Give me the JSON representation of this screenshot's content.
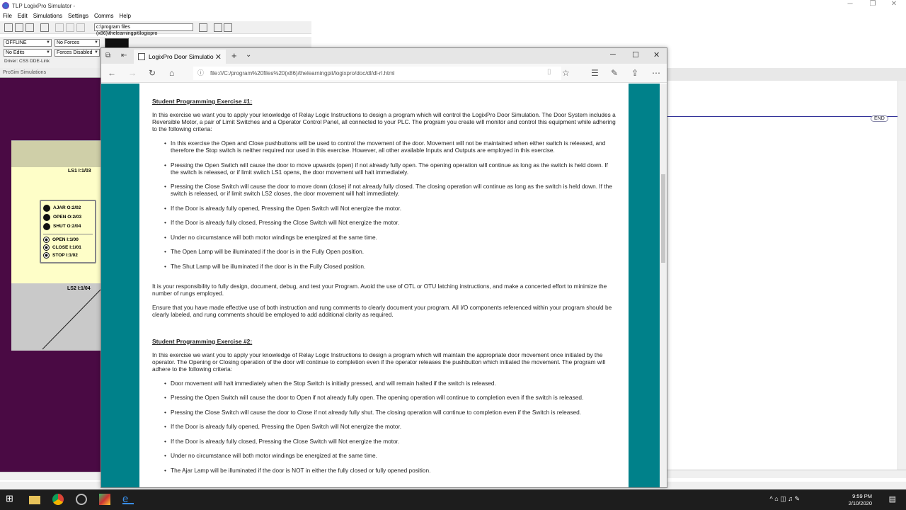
{
  "app": {
    "title": "TLP LogixPro Simulator -",
    "menu": [
      "File",
      "Edit",
      "Simulations",
      "Settings",
      "Comms",
      "Help"
    ],
    "path_field": "c:\\program files (x86)\\thelearningpit\\logixpro",
    "mode": "OFFLINE",
    "forces": "No Forces",
    "edits": "No Edits",
    "forces_disabled": "Forces Disabled",
    "driver": "Driver: CSS DDE-Link",
    "prosim_title": "ProSim Simulations",
    "end_label": "END"
  },
  "simulation": {
    "ls1": "LS1  I:1/03",
    "ls2": "LS2  I:1/04",
    "lamps": [
      {
        "label": "AJAR  O:2/02"
      },
      {
        "label": "OPEN  O:2/03"
      },
      {
        "label": "SHUT  O:2/04"
      }
    ],
    "buttons": [
      {
        "label": "OPEN   I:1/00"
      },
      {
        "label": "CLOSE I:1/01"
      },
      {
        "label": "STOP   I:1/02"
      }
    ]
  },
  "browser": {
    "tab_title": "LogixPro Door Simulatio",
    "url": "file:///C:/program%20files%20(x86)/thelearningpit/logixpro/doc/dl/dl-rl.html"
  },
  "doc": {
    "ex1_title": "Student Programming Exercise #1:",
    "ex1_intro": "In this exercise we want you to apply your knowledge of Relay Logic Instructions to design a program which will control the LogixPro Door Simulation. The Door System includes a Reversible Motor, a pair of Limit Switches and a Operator Control Panel, all connected to your PLC. The program you create will monitor and control this equipment while adhering to the following criteria:",
    "ex1_items": [
      "In this exercise the Open and Close pushbuttons will be used to control the movement of the door. Movement will not be maintained when either switch is released, and therefore the Stop switch is neither required nor used in this exercise. However, all other available Inputs and Outputs are employed in this exercise.",
      "Pressing the Open Switch will cause the door to move upwards (open) if not already fully open. The opening operation will continue as long as the switch is held down. If the switch is released, or if limit switch LS1 opens, the door movement will halt immediately.",
      "Pressing the Close Switch will cause the door to move down (close) if not already fully closed. The closing operation will continue as long as the switch is held down. If the switch is released, or if limit switch LS2 closes, the door movement will halt immediately.",
      "If the Door is already fully opened, Pressing the Open Switch will Not energize the motor.",
      "If the Door is already fully closed, Pressing the Close Switch will Not energize the motor.",
      "Under no circumstance will both motor windings be energized at the same time.",
      "The Open Lamp will be illuminated if the door is in the Fully Open position.",
      "The Shut Lamp will be illuminated if the door is in the Fully Closed position."
    ],
    "ex1_resp": "It is your responsibility to fully design, document, debug, and test your Program. Avoid the use of OTL or OTU latching instructions, and make a concerted effort to minimize the number of rungs employed.",
    "ex1_comments": "Ensure that you have made effective use of both instruction and rung comments to clearly document your program. All I/O components referenced within your program should be clearly labeled, and rung comments should be employed to add additional clarity as required.",
    "ex2_title": "Student Programming Exercise #2:",
    "ex2_intro": "In this exercise we want you to apply your knowledge of Relay Logic Instructions to design a program which will maintain the appropriate door movement once initiated by the operator. The Opening or Closing operation of the door will continue to completion even if the operator releases the pushbutton which initiated the movement. The program will adhere to the following criteria:",
    "ex2_items": [
      "Door movement will halt immediately when the Stop Switch is initially pressed, and will remain halted if the switch is released.",
      "Pressing the Open Switch will cause the door to Open if not already fully open. The opening operation will continue to completion even if the switch is released.",
      "Pressing the Close Switch will cause the door to Close if not already fully shut. The closing operation will continue to completion even if the Switch is released.",
      "If the Door is already fully opened, Pressing the Open Switch will Not energize the motor.",
      "If the Door is already fully closed, Pressing the Close Switch will Not energize the motor.",
      "Under no circumstance will both motor windings be energized at the same time.",
      "The Ajar Lamp will be illuminated if the door is NOT in either the fully closed or fully opened position."
    ]
  },
  "taskbar": {
    "time": "9:59 PM",
    "date": "2/10/2020"
  }
}
